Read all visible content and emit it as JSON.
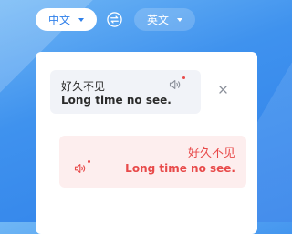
{
  "colors": {
    "primary": "#2f80ea",
    "accent_red": "#e84a4a",
    "source_bubble_bg": "#f1f3f8",
    "result_bubble_bg": "#fdeeee"
  },
  "language_bar": {
    "source_language": "中文",
    "target_language": "英文",
    "swap_icon": "swap-arrows-icon"
  },
  "conversation": {
    "source": {
      "text_zh": "好久不见",
      "text_en": "Long time no see.",
      "speaker_icon": "speaker-icon"
    },
    "result": {
      "text_zh": "好久不见",
      "text_en": "Long time no see.",
      "speaker_icon": "speaker-icon"
    },
    "close_icon": "close-icon"
  }
}
